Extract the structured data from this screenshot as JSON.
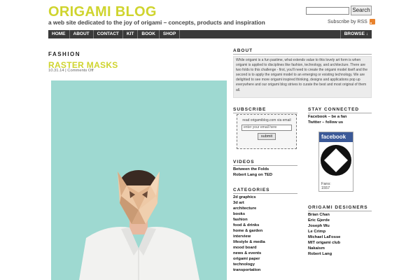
{
  "site": {
    "title": "ORIGAMI BLOG",
    "tagline": "a web site dedicated to the joy of origami – concepts, products and inspiration"
  },
  "search": {
    "button": "Search",
    "placeholder": ""
  },
  "rss": {
    "label": "Subscribe by RSS",
    "icon": "rss-icon"
  },
  "nav": {
    "items": [
      "HOME",
      "ABOUT",
      "CONTACT",
      "KIT",
      "BOOK",
      "SHOP"
    ],
    "browse": "BROWSE ↓"
  },
  "post": {
    "category": "FASHION",
    "title": "RASTER MASKS",
    "meta": "10.31.14 | Comments Off"
  },
  "about": {
    "heading": "ABOUT",
    "text": "While origami is a fun pastime, what extends value to this lovely art form is when origami is applied to disciplines like fashion, technology, and architecture. There are two folds to this challenge - first, you'll need to create the origami model itself and the second is to apply the origami model to an emerging or existing technology. We are delighted to see more origami inspired thinking, designs and applications pop up everywhere and our origami blog strives to curate the best and most original of them all."
  },
  "subscribe": {
    "heading": "SUBSCRIBE",
    "text": "read origamiblog.com via email",
    "input_placeholder": "enter your email here",
    "button": "submit"
  },
  "stay_connected": {
    "heading": "STAY CONNECTED",
    "links": [
      "Facebook – be a fan",
      "Twitter – follow us"
    ]
  },
  "facebook": {
    "label": "facebook",
    "fans_label": "Fans:",
    "fans_count": "1557"
  },
  "videos": {
    "heading": "VIDEOS",
    "links": [
      "Between the Folds",
      "Robert Lang on TED"
    ]
  },
  "categories": {
    "heading": "CATEGORIES",
    "links": [
      "2d graphics",
      "3d art",
      "architecture",
      "books",
      "fashion",
      "food & drinks",
      "home & garden",
      "interview",
      "lifestyle & media",
      "mood board",
      "news & events",
      "origami paper",
      "technology",
      "transportation"
    ]
  },
  "designers": {
    "heading": "ORIGAMI DESIGNERS",
    "links": [
      "Brian Chan",
      "Eric Gjerde",
      "Joseph Wu",
      "Le Crimp",
      "Michael LaFosse",
      "MIT origami club",
      "Nakaism",
      "Robert Lang"
    ]
  },
  "colors": {
    "accent": "#cfd42e",
    "nav_bg": "#3a3a3a",
    "image_bg": "#9ed9d1",
    "facebook": "#3b5998"
  }
}
